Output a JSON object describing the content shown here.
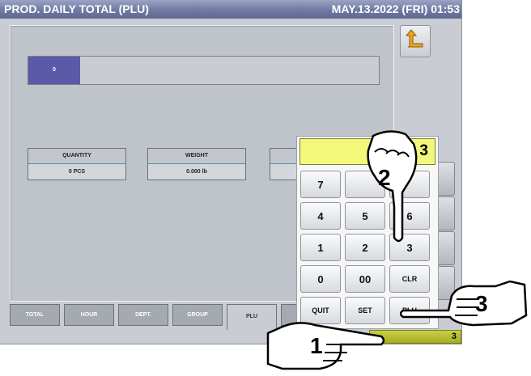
{
  "titlebar": {
    "title": "PROD. DAILY TOTAL (PLU)",
    "datetime": "MAY.13.2022 (FRI) 01:53"
  },
  "plu_row": {
    "code": "0"
  },
  "totals": {
    "quantity": {
      "label": "QUANTITY",
      "value": "0 PCS"
    },
    "weight": {
      "label": "WEIGHT",
      "value": "0.000 lb"
    }
  },
  "tabs": [
    {
      "label": "TOTAL"
    },
    {
      "label": "HOUR"
    },
    {
      "label": "DEPT."
    },
    {
      "label": "GROUP"
    },
    {
      "label": "PLU"
    }
  ],
  "keypad": {
    "display": "3",
    "keys": {
      "k7": "7",
      "k4": "4",
      "k5": "5",
      "k6": "6",
      "k1": "1",
      "k2": "2",
      "k3": "3",
      "k0": "0",
      "k00": "00",
      "clr": "CLR",
      "quit": "QUIT",
      "set": "SET",
      "plu": "PLU"
    }
  },
  "status": {
    "count": "3"
  },
  "callouts": {
    "step1": "1",
    "step2": "2",
    "step3": "3"
  },
  "icons": {
    "back": "return-arrow-icon",
    "hand": "pointing-hand-icon"
  },
  "colors": {
    "titlebar": "#6f7aa3",
    "display": "#f3f77a",
    "plu_code": "#5a5aa8",
    "status": "#b6bc30"
  }
}
